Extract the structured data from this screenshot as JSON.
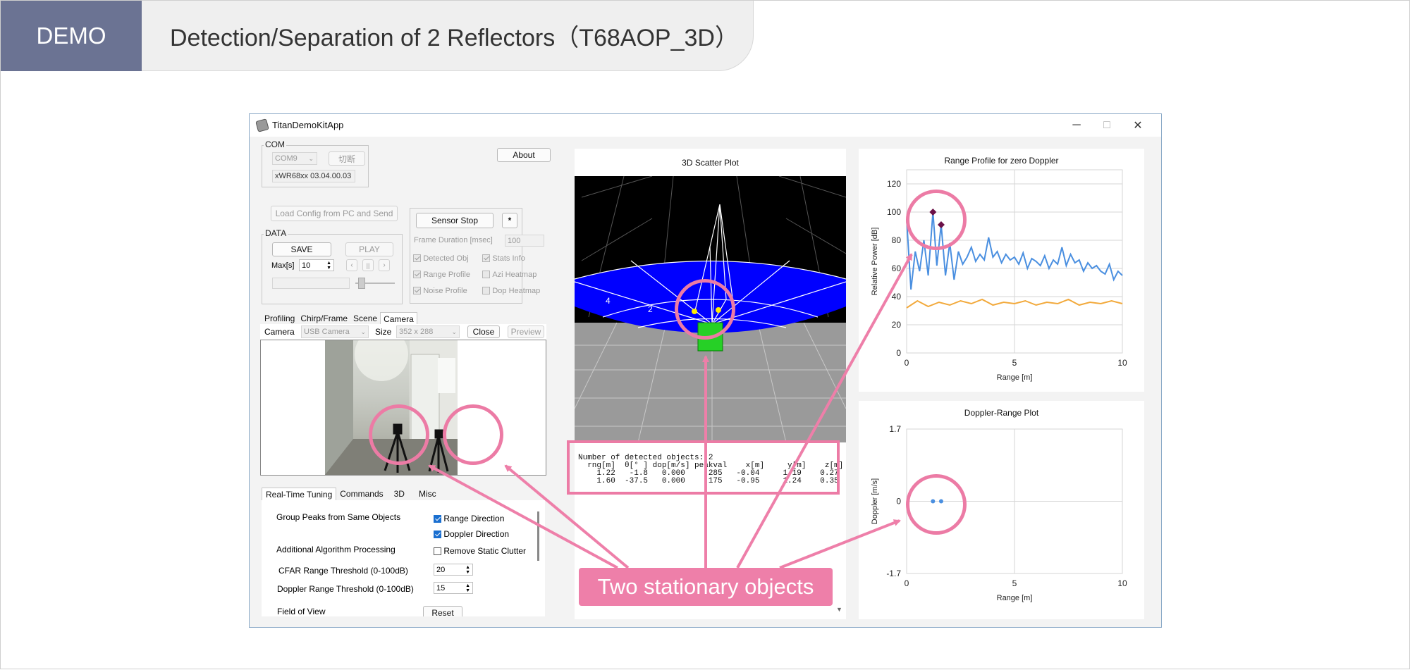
{
  "header": {
    "tag": "DEMO",
    "title": "Detection/Separation of 2 Reflectors（T68AOP_3D）"
  },
  "window": {
    "title": "TitanDemoKitApp",
    "minimize": "─",
    "maximize": "□",
    "close": "✕"
  },
  "left": {
    "com_group": "COM",
    "com_port": "COM9",
    "disconnect_label": "切断",
    "version": "xWR68xx  03.04.00.03",
    "about_label": "About",
    "load_config_label": "Load Config from PC and Send",
    "sensor_stop_label": "Sensor Stop",
    "star_label": "*",
    "frame_duration_label": "Frame Duration [msec]",
    "frame_duration_value": "100",
    "data_group": "DATA",
    "save_label": "SAVE",
    "play_label": "PLAY",
    "max_label": "Max[s]",
    "max_value": "10",
    "checks": {
      "detected_obj": "Detected Obj",
      "stats_info": "Stats Info",
      "range_profile": "Range Profile",
      "azi_heatmap": "Azi Heatmap",
      "noise_profile": "Noise Profile",
      "dop_heatmap": "Dop Heatmap"
    },
    "tabs": [
      "Profiling",
      "Chirp/Frame",
      "Scene",
      "Camera"
    ],
    "camera_label": "Camera",
    "camera_value": "USB Camera",
    "size_label": "Size",
    "size_value": "352 x 288",
    "close_label": "Close",
    "preview_label": "Preview",
    "bottom_tabs": [
      "Real-Time Tuning",
      "Commands",
      "3D",
      "Misc"
    ],
    "tuning": {
      "group_peaks": "Group Peaks from Same Objects",
      "range_direction": "Range Direction",
      "doppler_direction": "Doppler Direction",
      "additional_processing": "Additional Algorithm Processing",
      "remove_static": "Remove Static Clutter",
      "cfar_range_label": "CFAR Range Threshold (0-100dB)",
      "cfar_range_value": "20",
      "doppler_range_label": "Doppler Range Threshold (0-100dB)",
      "doppler_range_value": "15",
      "field_of_view": "Field of View",
      "reset_label": "Reset"
    }
  },
  "scatter": {
    "title": "3D Scatter Plot",
    "ring_labels": [
      "4",
      "2"
    ],
    "table_text": "Number of detected objects: 2\n  rng[m]  θ[° ] dop[m/s] peakval    x[m]     y[m]    z[m]\n    1.22   -1.8   0.000     285   -0.04     1.19    0.27\n    1.60  -37.5   0.000     175   -0.95     1.24    0.35"
  },
  "chart_data": [
    {
      "type": "line",
      "title": "Range Profile for zero Doppler",
      "xlabel": "Range [m]",
      "ylabel": "Relative Power [dB]",
      "xlim": [
        0,
        10
      ],
      "ylim": [
        0,
        130
      ],
      "xticks": [
        "0",
        "5",
        "10"
      ],
      "yticks": [
        "0",
        "20",
        "40",
        "60",
        "80",
        "100",
        "120"
      ],
      "grid": true,
      "series": [
        {
          "color": "#4a8fe0",
          "x": [
            0,
            0.2,
            0.4,
            0.6,
            0.8,
            1.0,
            1.22,
            1.4,
            1.6,
            1.8,
            2.0,
            2.2,
            2.4,
            2.6,
            2.8,
            3.0,
            3.2,
            3.4,
            3.6,
            3.8,
            4.0,
            4.2,
            4.4,
            4.6,
            4.8,
            5.0,
            5.2,
            5.4,
            5.6,
            5.8,
            6.0,
            6.2,
            6.4,
            6.6,
            6.8,
            7.0,
            7.2,
            7.4,
            7.6,
            7.8,
            8.0,
            8.2,
            8.4,
            8.6,
            8.8,
            9.0,
            9.2,
            9.4,
            9.6,
            9.8,
            10.0
          ],
          "values": [
            95,
            45,
            72,
            58,
            80,
            55,
            100,
            62,
            91,
            55,
            78,
            52,
            72,
            63,
            68,
            75,
            65,
            70,
            66,
            82,
            68,
            72,
            64,
            70,
            66,
            68,
            63,
            71,
            60,
            67,
            65,
            62,
            69,
            60,
            66,
            63,
            75,
            62,
            70,
            64,
            66,
            58,
            64,
            60,
            62,
            58,
            56,
            63,
            52,
            58,
            55
          ]
        },
        {
          "color": "#f2a93b",
          "x": [
            0,
            0.5,
            1,
            1.5,
            2,
            2.5,
            3,
            3.5,
            4,
            4.5,
            5,
            5.5,
            6,
            6.5,
            7,
            7.5,
            8,
            8.5,
            9,
            9.5,
            10
          ],
          "values": [
            32,
            37,
            33,
            36,
            34,
            37,
            35,
            38,
            34,
            36,
            35,
            37,
            34,
            36,
            35,
            38,
            34,
            36,
            35,
            37,
            35
          ]
        }
      ],
      "markers": [
        {
          "x": 1.22,
          "y": 100
        },
        {
          "x": 1.6,
          "y": 91
        }
      ]
    },
    {
      "type": "scatter",
      "title": "Doppler-Range Plot",
      "xlabel": "Range [m]",
      "ylabel": "Doppler [m/s]",
      "xlim": [
        0,
        10
      ],
      "ylim": [
        -1.7,
        1.7
      ],
      "xticks": [
        "0",
        "5",
        "10"
      ],
      "yticks": [
        "1.7",
        "0",
        "-1.7"
      ],
      "grid": true,
      "points": [
        {
          "x": 1.22,
          "y": 0
        },
        {
          "x": 1.6,
          "y": 0
        }
      ]
    }
  ],
  "callout": {
    "text": "Two stationary objects"
  },
  "colors": {
    "accent": "#ee7fa9",
    "tag": "#6b7393"
  }
}
